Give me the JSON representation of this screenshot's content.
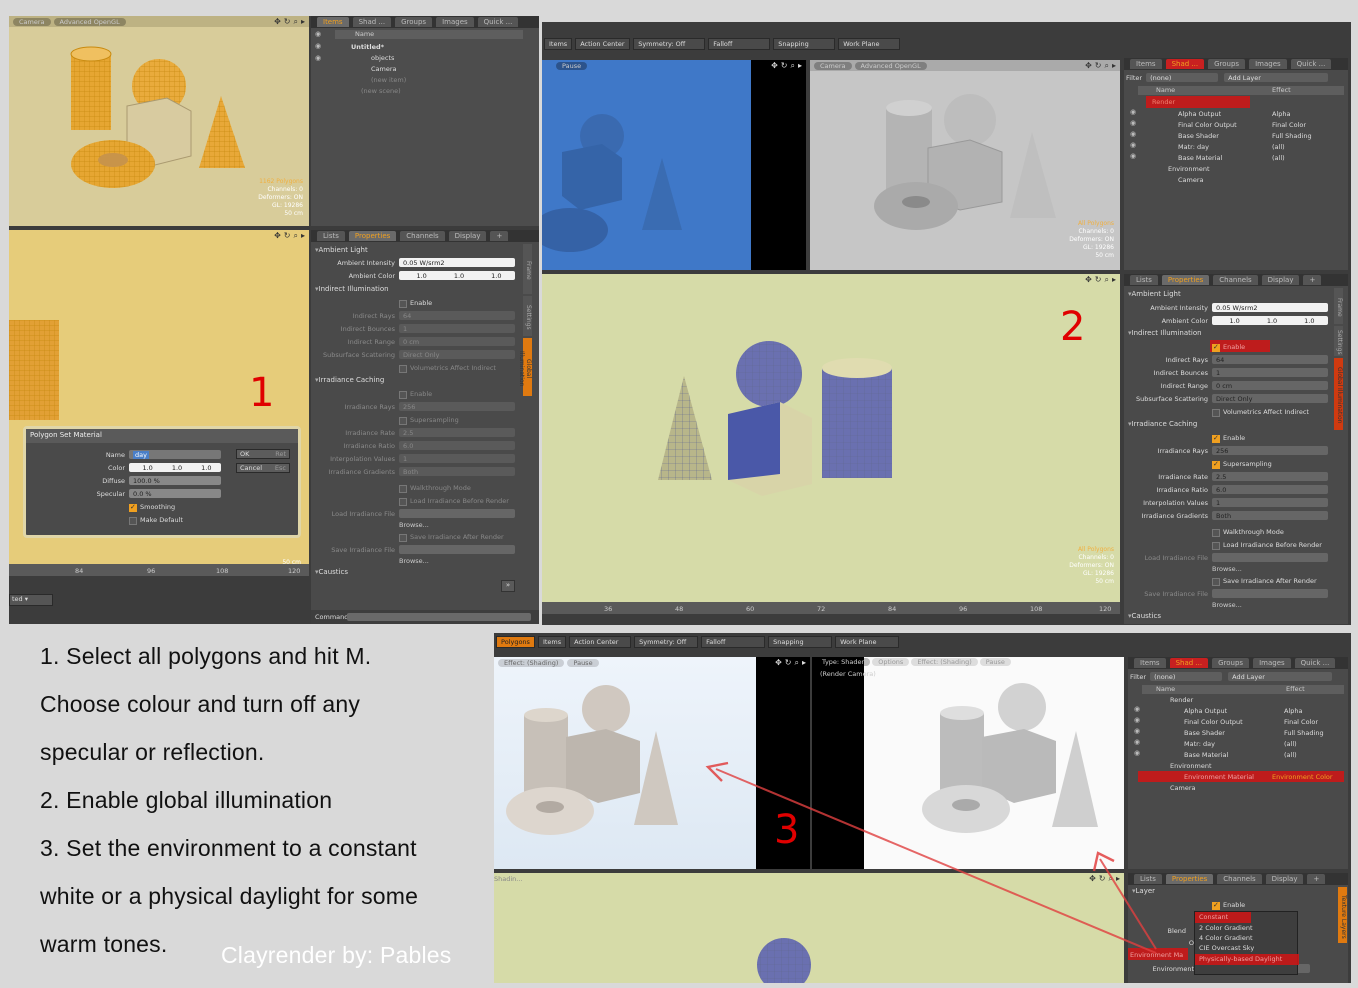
{
  "panel1": {
    "viewport_tabs": [
      "Camera",
      "Advanced OpenGL"
    ],
    "viewport_stats": [
      "1162 Polygons",
      "Channels: 0",
      "Deformers: ON",
      "GL: 19286",
      "50 cm"
    ],
    "list_tabs": [
      "Items",
      "Shad ...",
      "Groups",
      "Images",
      "Quick ..."
    ],
    "list_header": "Name",
    "list_items": [
      "Untitled*",
      "objects",
      "Camera",
      "(new item)",
      "(new scene)"
    ],
    "props_tabs": [
      "Lists",
      "Properties",
      "Channels",
      "Display",
      "+"
    ],
    "side_tabs": [
      "Frame",
      "Settings",
      "Global Illumination"
    ],
    "sections": {
      "ambient": "Ambient Light",
      "indirect": "Indirect Illumination",
      "irr": "Irradiance Caching",
      "caustics": "Caustics"
    },
    "ambient_intensity": {
      "label": "Ambient Intensity",
      "value": "0.05 W/srm2"
    },
    "ambient_color": {
      "label": "Ambient Color",
      "values": [
        "1.0",
        "1.0",
        "1.0"
      ]
    },
    "enable": "Enable",
    "indirect_rows": [
      {
        "label": "Indirect Rays",
        "value": "64"
      },
      {
        "label": "Indirect Bounces",
        "value": "1"
      },
      {
        "label": "Indirect Range",
        "value": "0 cm"
      },
      {
        "label": "Subsurface Scattering",
        "value": "Direct Only"
      }
    ],
    "vol": "Volumetrics Affect Indirect",
    "irr_rays": {
      "label": "Irradiance Rays",
      "value": "256"
    },
    "supersampling": "Supersampling",
    "irr_rows": [
      {
        "label": "Irradiance Rate",
        "value": "2.5"
      },
      {
        "label": "Irradiance Ratio",
        "value": "6.0"
      },
      {
        "label": "Interpolation Values",
        "value": "1"
      },
      {
        "label": "Irradiance Gradients",
        "value": "Both"
      }
    ],
    "walkthrough": "Walkthrough Mode",
    "load_before": "Load Irradiance Before Render",
    "load_file": "Load Irradiance File",
    "browse": "Browse...",
    "save_after": "Save Irradiance After Render",
    "save_file": "Save Irradiance File",
    "command": "Command",
    "ruler": [
      "84",
      "96",
      "108",
      "120"
    ],
    "bottom_dropdown": "ted",
    "dialog": {
      "title": "Polygon Set Material",
      "name_label": "Name",
      "name_value": "day",
      "color_label": "Color",
      "color_values": [
        "1.0",
        "1.0",
        "1.0"
      ],
      "diffuse_label": "Diffuse",
      "diffuse_value": "100.0 %",
      "specular_label": "Specular",
      "specular_value": "0.0 %",
      "smoothing": "Smoothing",
      "make_default": "Make Default",
      "ok": "OK",
      "ok_key": "Ret",
      "cancel": "Cancel",
      "cancel_key": "Esc"
    },
    "step_number": "1"
  },
  "panel2": {
    "toolbar": [
      "Items",
      "Action Center",
      "Symmetry: Off",
      "Falloff",
      "Snapping",
      "Work Plane"
    ],
    "pause": "Pause",
    "viewport_tabs": [
      "Camera",
      "Advanced OpenGL"
    ],
    "stats": [
      "All Polygons",
      "Channels: 0",
      "Deformers: ON",
      "GL: 19286",
      "50 cm"
    ],
    "shader_tabs": [
      "Items",
      "Shad ...",
      "Groups",
      "Images",
      "Quick ...",
      "+"
    ],
    "filter_label": "Filter",
    "filter_value": "(none)",
    "add_layer": "Add Layer",
    "cols": [
      "Name",
      "Effect"
    ],
    "tree": [
      {
        "name": "Render",
        "effect": ""
      },
      {
        "name": "Alpha Output",
        "effect": "Alpha"
      },
      {
        "name": "Final Color Output",
        "effect": "Final Color"
      },
      {
        "name": "Base Shader",
        "effect": "Full Shading"
      },
      {
        "name": "Matr: day",
        "effect": "(all)"
      },
      {
        "name": "Base Material",
        "effect": "(all)"
      },
      {
        "name": "Environment",
        "effect": ""
      },
      {
        "name": "Camera",
        "effect": ""
      }
    ],
    "props_tabs": [
      "Lists",
      "Properties",
      "Channels",
      "Display",
      "+"
    ],
    "side_tabs": [
      "Frame",
      "Settings",
      "Global Illumination"
    ],
    "bottom_stats": [
      "All Polygons",
      "Channels: 0",
      "Deformers: ON",
      "GL: 19286",
      "50 cm"
    ],
    "ruler": [
      "36",
      "48",
      "60",
      "72",
      "84",
      "96",
      "108",
      "120"
    ],
    "step_number": "2"
  },
  "panel3": {
    "toolbar": [
      "Polygons",
      "Items",
      "Action Center",
      "Symmetry: Off",
      "Falloff",
      "Snapping",
      "Work Plane"
    ],
    "left_tabs": [
      "Effect: (Shading)",
      "Pause"
    ],
    "right_tabs": [
      "Type: Shader",
      "Options",
      "Effect: (Shading)",
      "Pause"
    ],
    "render_camera": "(Render Camera)",
    "shader_tabs": [
      "Items",
      "Shad ...",
      "Groups",
      "Images",
      "Quick ...",
      "+"
    ],
    "filter_label": "Filter",
    "filter_value": "(none)",
    "add_layer": "Add Layer",
    "cols": [
      "Name",
      "Effect"
    ],
    "tree": [
      {
        "name": "Render",
        "effect": ""
      },
      {
        "name": "Alpha Output",
        "effect": "Alpha"
      },
      {
        "name": "Final Color Output",
        "effect": "Final Color"
      },
      {
        "name": "Base Shader",
        "effect": "Full Shading"
      },
      {
        "name": "Matr: day",
        "effect": "(all)"
      },
      {
        "name": "Base Material",
        "effect": "(all)"
      },
      {
        "name": "Environment",
        "effect": ""
      },
      {
        "name": "Environment Material",
        "effect": "Environment Color"
      },
      {
        "name": "Camera",
        "effect": ""
      }
    ],
    "props_tabs": [
      "Lists",
      "Properties",
      "Channels",
      "Display",
      "+"
    ],
    "layer": "Layer",
    "enable": "Enable",
    "blend": "Blend",
    "op": "O",
    "env_ma": "Environment Ma",
    "environment": "Environment",
    "ght": "ght",
    "dropdown": [
      "Constant",
      "2 Color Gradient",
      "4 Color Gradient",
      "CIE Overcast Sky",
      "Physically-based Daylight"
    ],
    "side_tab": "Texture Layers",
    "shadin": "Shadin...",
    "step_number": "3"
  },
  "notes": {
    "l1": "1.  Select  all  polygons  and  hit  M.",
    "l2": "Choose   colour   and   turn   off   any",
    "l3": "specular or reflection.",
    "l4": "2. Enable global illumination",
    "l5": "3. Set the environment to a constant",
    "l6": "white or a physical daylight for some",
    "l7": "warm tones.",
    "credit": "Clayrender by: Pables"
  },
  "colors": {
    "accent": "#f0a020",
    "highlight": "#d01818",
    "annot": "#e00000"
  }
}
